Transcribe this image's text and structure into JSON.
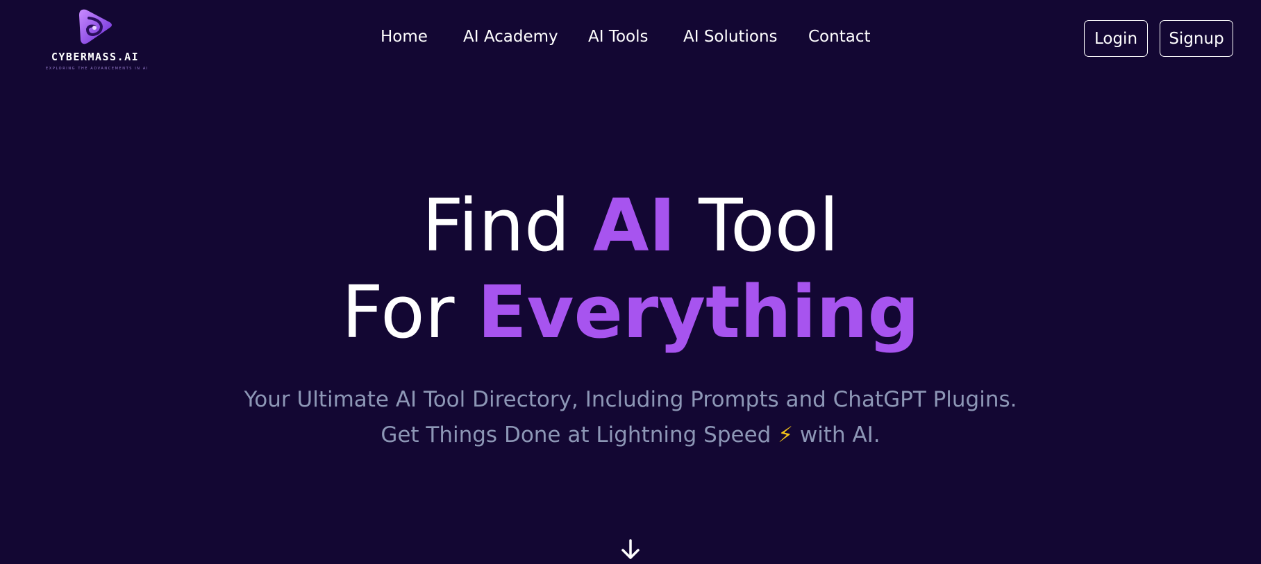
{
  "logo": {
    "name": "CYBERMASS.AI",
    "tagline": "EXPLORING THE ADVANCEMENTS IN AI",
    "icon": "swirl-logo-icon"
  },
  "nav": {
    "items": [
      "Home",
      "AI Academy",
      "AI Tools",
      "AI Solutions",
      "Contact"
    ]
  },
  "auth": {
    "login_label": "Login",
    "signup_label": "Signup"
  },
  "hero": {
    "line1": {
      "part1": "Find ",
      "accent": "AI",
      "part2": " Tool"
    },
    "line2": {
      "part1": "For ",
      "accent": "Everything"
    },
    "subtitle1": "Your Ultimate AI Tool Directory, Including Prompts and ChatGPT Plugins.",
    "subtitle2_before": "Get Things Done at Lightning Speed ",
    "subtitle2_emoji": "⚡",
    "subtitle2_after": " with AI.",
    "scroll_icon": "arrow-down-icon"
  },
  "colors": {
    "background": "#130733",
    "accent": "#a754ef",
    "subtitle": "#8d97b6"
  }
}
